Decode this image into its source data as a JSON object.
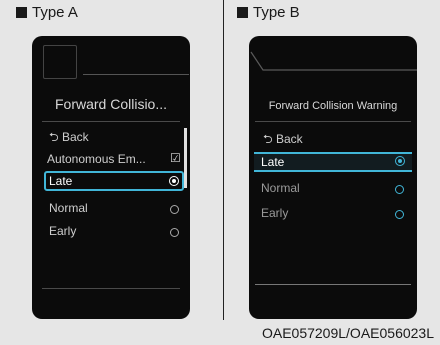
{
  "header": {
    "type_a": "Type A",
    "type_b": "Type B"
  },
  "caption": "OAE057209L/OAE056023L",
  "screen_a": {
    "title": "Forward Collisio...",
    "back_label": "Back",
    "back_icon": "back-arrow-icon",
    "options": [
      {
        "label": "Autonomous Em...",
        "control": "checkbox",
        "checked": true
      },
      {
        "label": "Late",
        "control": "radio",
        "selected": true
      },
      {
        "label": "Normal",
        "control": "radio",
        "selected": false
      },
      {
        "label": "Early",
        "control": "radio",
        "selected": false
      }
    ]
  },
  "screen_b": {
    "title": "Forward Collision Warning",
    "back_label": "Back",
    "back_icon": "back-arrow-icon",
    "options": [
      {
        "label": "Late",
        "control": "radio",
        "selected": true
      },
      {
        "label": "Normal",
        "control": "radio",
        "selected": false
      },
      {
        "label": "Early",
        "control": "radio",
        "selected": false
      }
    ]
  },
  "colors": {
    "highlight": "#41b6d8",
    "screen_bg": "#0b0b0b",
    "page_bg": "#e6e6e6"
  }
}
